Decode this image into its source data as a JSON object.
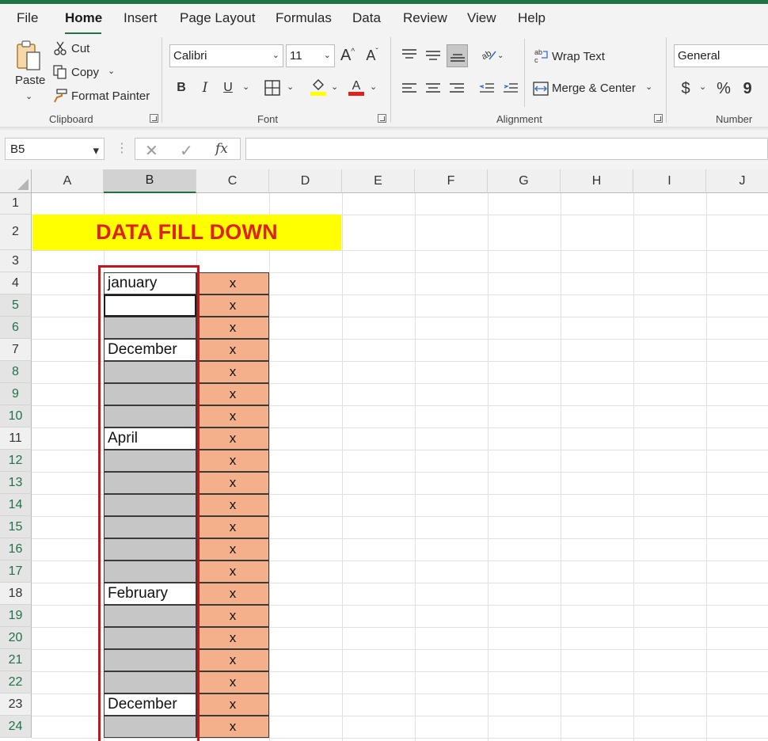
{
  "menu": {
    "items": [
      "File",
      "Home",
      "Insert",
      "Page Layout",
      "Formulas",
      "Data",
      "Review",
      "View",
      "Help"
    ],
    "active": "Home"
  },
  "ribbon": {
    "clipboard": {
      "label": "Clipboard",
      "paste": "Paste",
      "cut": "Cut",
      "copy": "Copy",
      "format_painter": "Format Painter"
    },
    "font": {
      "label": "Font",
      "name": "Calibri",
      "size": "11",
      "bold": "B",
      "italic": "I",
      "underline": "U"
    },
    "alignment": {
      "label": "Alignment",
      "wrap_text": "Wrap Text",
      "merge_center": "Merge & Center"
    },
    "number": {
      "label": "Number",
      "format": "General",
      "currency": "$",
      "percent": "%",
      "comma": "9"
    }
  },
  "formula_bar": {
    "name_box": "B5",
    "fx": "fx",
    "formula": ""
  },
  "sheet": {
    "columns": [
      "A",
      "B",
      "C",
      "D",
      "E",
      "F",
      "G",
      "H",
      "I",
      "J"
    ],
    "selected_column": "B",
    "selected_cell": "B5",
    "title": "DATA FILL DOWN",
    "rows": [
      {
        "n": "1"
      },
      {
        "n": "2"
      },
      {
        "n": "3"
      },
      {
        "n": "4",
        "b": "january",
        "type": "filled",
        "c": "x"
      },
      {
        "n": "5",
        "b": "",
        "type": "active",
        "c": "x"
      },
      {
        "n": "6",
        "b": "",
        "type": "blank",
        "c": "x"
      },
      {
        "n": "7",
        "b": "December",
        "type": "filled",
        "c": "x"
      },
      {
        "n": "8",
        "b": "",
        "type": "blank",
        "c": "x"
      },
      {
        "n": "9",
        "b": "",
        "type": "blank",
        "c": "x"
      },
      {
        "n": "10",
        "b": "",
        "type": "blank",
        "c": "x"
      },
      {
        "n": "11",
        "b": "April",
        "type": "filled",
        "c": "x"
      },
      {
        "n": "12",
        "b": "",
        "type": "blank",
        "c": "x"
      },
      {
        "n": "13",
        "b": "",
        "type": "blank",
        "c": "x"
      },
      {
        "n": "14",
        "b": "",
        "type": "blank",
        "c": "x"
      },
      {
        "n": "15",
        "b": "",
        "type": "blank",
        "c": "x"
      },
      {
        "n": "16",
        "b": "",
        "type": "blank",
        "c": "x"
      },
      {
        "n": "17",
        "b": "",
        "type": "blank",
        "c": "x"
      },
      {
        "n": "18",
        "b": "February",
        "type": "filled",
        "c": "x"
      },
      {
        "n": "19",
        "b": "",
        "type": "blank",
        "c": "x"
      },
      {
        "n": "20",
        "b": "",
        "type": "blank",
        "c": "x"
      },
      {
        "n": "21",
        "b": "",
        "type": "blank",
        "c": "x"
      },
      {
        "n": "22",
        "b": "",
        "type": "blank",
        "c": "x"
      },
      {
        "n": "23",
        "b": "December",
        "type": "filled",
        "c": "x"
      },
      {
        "n": "24",
        "b": "",
        "type": "blank",
        "c": "x"
      }
    ]
  },
  "colors": {
    "accent": "#217346",
    "title_fill": "#ffff00",
    "title_text": "#e0201b",
    "column_c_fill": "#f4b08a",
    "blank_fill": "#c6c6c6",
    "frame": "#c0161a"
  }
}
